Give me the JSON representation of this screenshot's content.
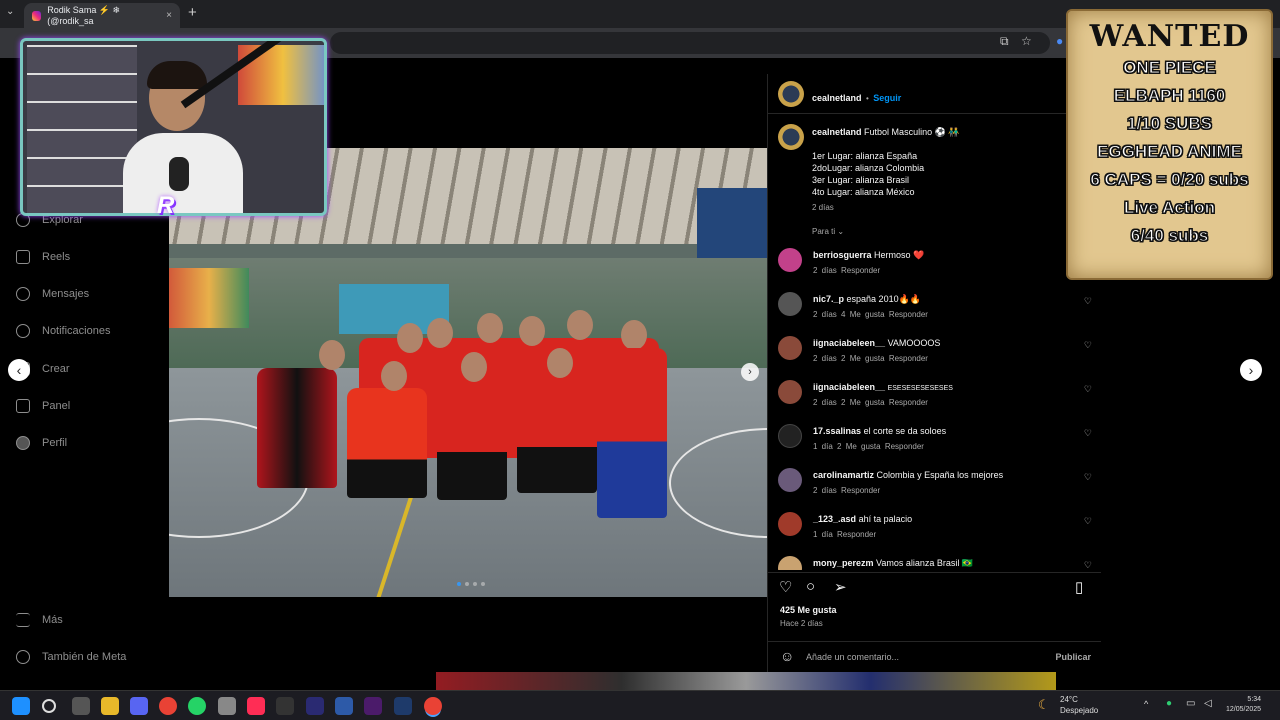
{
  "browser": {
    "tab_title": "Rodik Sama ⚡ ❄ (@rodik_sa",
    "tab_close": "×",
    "new_tab": "+",
    "tab_menu": "⌄"
  },
  "nav": {
    "items": [
      {
        "label": "Explorar",
        "icon": "compass-icon"
      },
      {
        "label": "Reels",
        "icon": "reels-icon"
      },
      {
        "label": "Mensajes",
        "icon": "messages-icon"
      },
      {
        "label": "Notificaciones",
        "icon": "heart-icon"
      },
      {
        "label": "Crear",
        "icon": "plus-icon"
      },
      {
        "label": "Panel",
        "icon": "dashboard-icon"
      },
      {
        "label": "Perfil",
        "icon": "profile-icon"
      }
    ],
    "more": "Más",
    "meta": "También de Meta"
  },
  "post": {
    "username": "cealnetland",
    "dot": "•",
    "follow": "Seguir",
    "caption_title": "Futbol Masculino ⚽ 👬",
    "caption_lines": [
      "1er Lugar: alianza España",
      "2doLugar: alianza Colombia",
      "3er Lugar: alianza Brasil",
      "4to Lugar: alianza México"
    ],
    "caption_time": "2 días",
    "para_ti": "Para ti ⌄",
    "likes": "425 Me gusta",
    "posted": "Hace 2 días",
    "comment_placeholder": "Añade un comentario...",
    "publish": "Publicar",
    "emoji_icon": "☺"
  },
  "comments": [
    {
      "user": "berriosguerra",
      "text": "Hermoso ❤️",
      "meta": "2 días  Responder",
      "color": "#c2418a"
    },
    {
      "user": "nic7._p",
      "text": "españa 2010🔥🔥",
      "meta": "2 días  4 Me gusta  Responder",
      "color": "#555555"
    },
    {
      "user": "iignaciabeleen__",
      "text": "VAMOOOOS",
      "meta": "2 días  2 Me gusta  Responder",
      "color": "#8a4a3a"
    },
    {
      "user": "iignaciabeleen__",
      "text": "ESESESESESESES",
      "meta": "2 días  2 Me gusta  Responder",
      "color": "#8a4a3a"
    },
    {
      "user": "17.ssalinas",
      "text": "el corte se da soloes",
      "meta": "1 día  2 Me gusta  Responder",
      "color": "#222222"
    },
    {
      "user": "carolinamartiz",
      "text": "Colombia y España los mejores",
      "meta": "2 días  Responder",
      "color": "#6a5a7a"
    },
    {
      "user": "_123_.asd",
      "text": "ahí ta palacio",
      "meta": "1 día  Responder",
      "color": "#a03a2a"
    },
    {
      "user": "mony_perezm",
      "text": "Vamos alianza Brasil 🇧🇷",
      "meta": "",
      "color": "#c9a270"
    }
  ],
  "wanted": {
    "title": "WANTED",
    "lines": [
      "ONE PIECE",
      "ELBAPH 1160",
      "1/10 SUBS",
      "EGGHEAD ANIME",
      "6 CAPS = 0/20 subs",
      "Live Action",
      "6/40 subs"
    ]
  },
  "taskbar": {
    "temp": "24°C",
    "weather": "Despejado",
    "time": "5:34",
    "date": "12/05/2025",
    "apps": [
      "#1e90ff",
      "#444",
      "#555",
      "#e8b82a",
      "#5865f2",
      "#e94235",
      "#25d366",
      "#888",
      "#ff2d55",
      "#333",
      "#2a2a72",
      "#2d5aa8",
      "#4b1b6a",
      "#1e3a6a",
      "#e94235"
    ]
  }
}
